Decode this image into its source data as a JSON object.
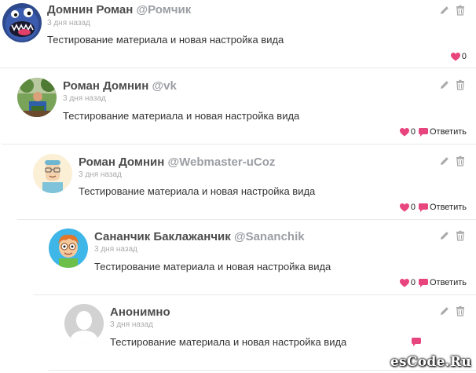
{
  "colors": {
    "accent_pink": "#e8457f",
    "name_gray": "#4d4d4d",
    "login_gray": "#9b9ea3",
    "date_gray": "#aaaaaa",
    "icon_gray": "#a9a9a9",
    "separator": "#e9e9e9"
  },
  "comments": [
    {
      "author": "Домнин Роман",
      "login": "@Ромчик",
      "date": "3 дня назад",
      "text": "Тестирование материала и новая настройка вида",
      "likes": "0",
      "reply_label": "",
      "avatar": "monster-avatar"
    },
    {
      "author": "Роман Домнин",
      "login": "@vk",
      "date": "3 дня назад",
      "text": "Тестирование материала и новая настройка вида",
      "likes": "0",
      "reply_label": "Ответить",
      "avatar": "photo-avatar"
    },
    {
      "author": "Роман Домнин",
      "login": "@Webmaster-uCoz",
      "date": "3 дня назад",
      "text": "Тестирование материала и новая настройка вида",
      "likes": "0",
      "reply_label": "Ответить",
      "avatar": "cartoon-man-avatar"
    },
    {
      "author": "Сананчик Баклажанчик",
      "login": "@Sananchik",
      "date": "3 дня назад",
      "text": "Тестирование материала и новая настройка вида",
      "likes": "0",
      "reply_label": "Ответить",
      "avatar": "cartoon-boy-avatar"
    },
    {
      "author": "Анонимно",
      "login": "",
      "date": "3 дня назад",
      "text": "Тестирование материала и новая настройка вида",
      "likes": "",
      "reply_label": "",
      "avatar": "default-user-avatar"
    }
  ],
  "watermark": "esCode.Ru"
}
